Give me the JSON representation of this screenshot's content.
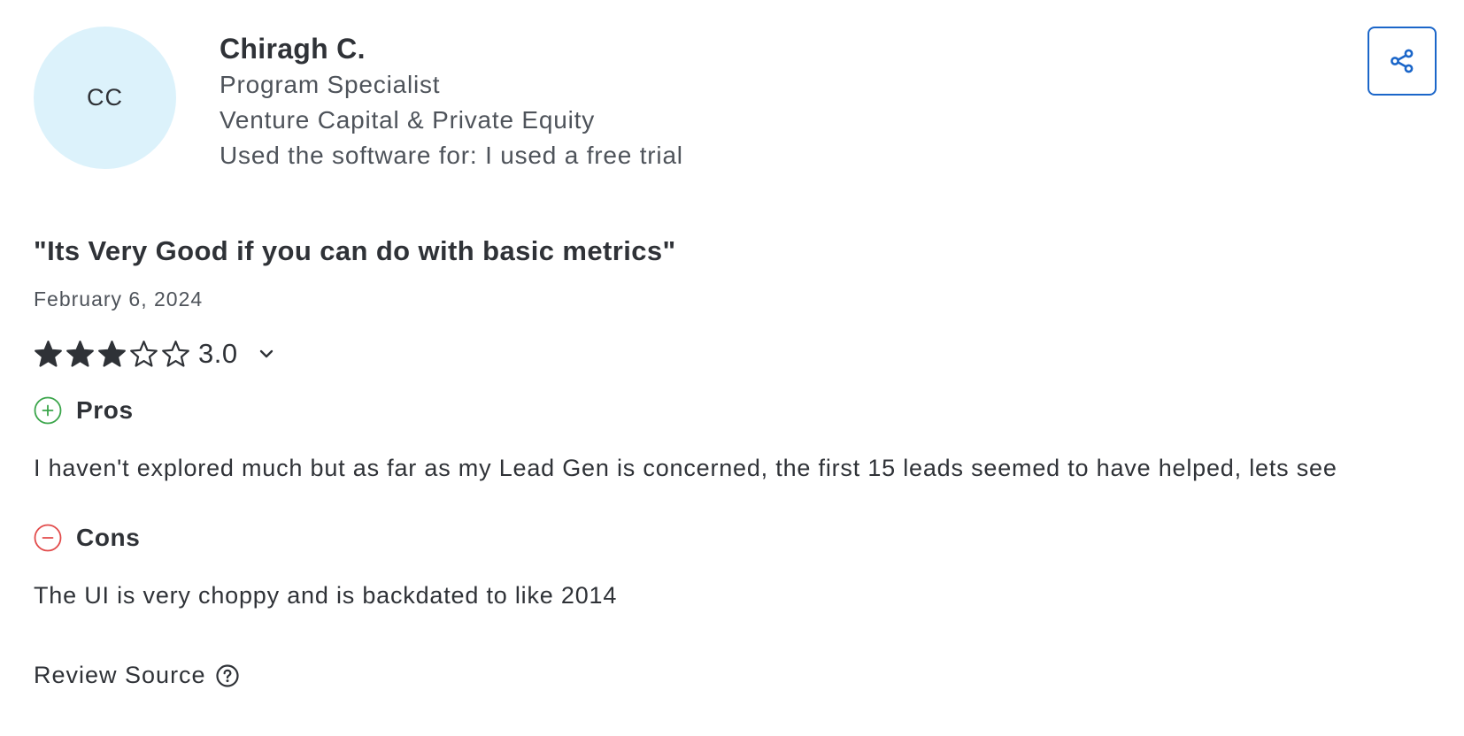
{
  "reviewer": {
    "initials": "CC",
    "name": "Chiragh C.",
    "role": "Program Specialist",
    "industry": "Venture Capital & Private Equity",
    "usage": "Used the software for: I used a free trial",
    "avatar_color": "#dcf2fb"
  },
  "share": {
    "icon": "share-icon",
    "color": "#1b66c9"
  },
  "review": {
    "title": "\"Its Very Good if you can do with basic metrics\"",
    "date": "February 6, 2024",
    "rating": {
      "value": 3.0,
      "display": "3.0",
      "max": 5,
      "expand_icon": "chevron-down-icon"
    },
    "pros": {
      "label": "Pros",
      "icon": "plus-circle-icon",
      "icon_color": "#3aa54a",
      "text": "I haven't explored much but as far as my Lead Gen is concerned, the first 15 leads seemed to have helped, lets see"
    },
    "cons": {
      "label": "Cons",
      "icon": "minus-circle-icon",
      "icon_color": "#e24b4b",
      "text": "The UI is very choppy and is backdated to like 2014"
    }
  },
  "review_source": {
    "label": "Review Source",
    "icon": "help-circle-icon"
  }
}
